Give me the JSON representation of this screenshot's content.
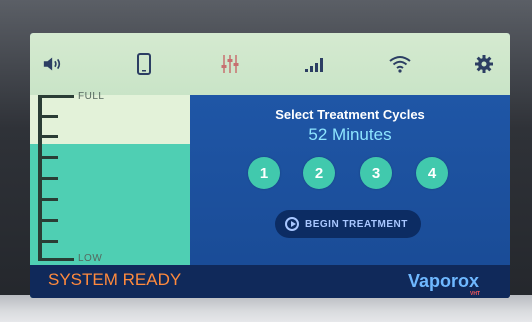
{
  "topbar": {
    "icons": [
      "volume-icon",
      "phone-icon",
      "equalizer-icon",
      "signal-icon",
      "wifi-icon",
      "gear-icon"
    ]
  },
  "gauge": {
    "full_label": "FULL",
    "low_label": "LOW",
    "fill_level": 0.76
  },
  "panel": {
    "title": "Select Treatment Cycles",
    "minutes": "52 Minutes",
    "cycles": [
      "1",
      "2",
      "3",
      "4"
    ],
    "begin_label": "BEGIN TREATMENT"
  },
  "status": {
    "text": "SYSTEM READY",
    "brand": "Vaporox",
    "brand_sub": "VHT"
  },
  "colors": {
    "accent": "#41c9ad",
    "status": "#ff8a3d",
    "brand": "#6fb8ff"
  }
}
